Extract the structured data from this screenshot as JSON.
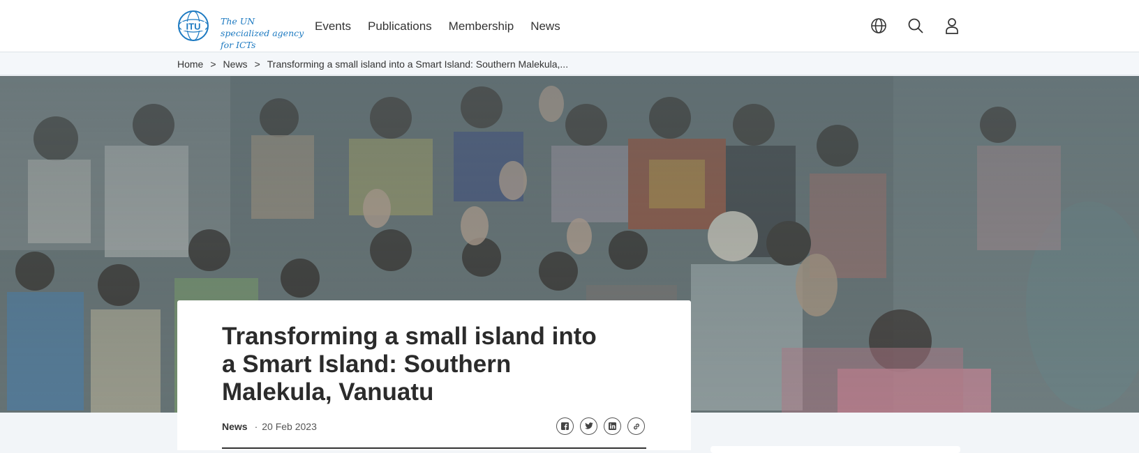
{
  "header": {
    "logo_text": "ITU",
    "tagline": "The UN specialized agency for ICTs",
    "nav": [
      {
        "label": "Events"
      },
      {
        "label": "Publications"
      },
      {
        "label": "Membership"
      },
      {
        "label": "News"
      }
    ],
    "icons": [
      "globe-icon",
      "search-icon",
      "user-icon"
    ]
  },
  "breadcrumb": {
    "items": [
      "Home",
      "News",
      "Transforming a small island into a Smart Island: Southern Malekula,..."
    ],
    "separator": ">"
  },
  "article": {
    "title": "Transforming a small island into a Smart Island: Southern Malekula, Vanuatu",
    "category": "News",
    "date": "20 Feb 2023",
    "share_icons": [
      "facebook-icon",
      "twitter-icon",
      "linkedin-icon",
      "link-icon"
    ]
  },
  "colors": {
    "brand_blue": "#1d7ac1",
    "text": "#2b2b2b",
    "header_bg": "#ffffff",
    "breadcrumb_bg": "#f4f7fa"
  }
}
